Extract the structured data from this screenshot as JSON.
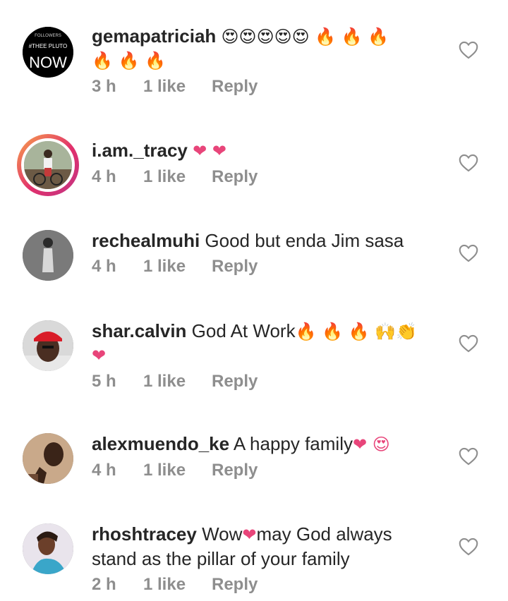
{
  "comments": [
    {
      "username": "gemapatriciah",
      "text": "",
      "emojis_line1": "😍😍😍😍😍 🔥 🔥 🔥",
      "emojis_line2": "🔥 🔥 🔥",
      "time": "3 h",
      "likes": "1 like",
      "reply": "Reply",
      "avatar_text_top": "FOLLOWERS",
      "avatar_text_mid": "#THEE PLUTO",
      "avatar_text_bottom": "NOW"
    },
    {
      "username": "i.am._tracy",
      "text": "",
      "emojis_line1": "❤ ❤",
      "time": "4 h",
      "likes": "1 like",
      "reply": "Reply"
    },
    {
      "username": "rechealmuhi",
      "text": "Good but enda Jim sasa",
      "time": "4 h",
      "likes": "1 like",
      "reply": "Reply"
    },
    {
      "username": "shar.calvin",
      "text": "God At Work",
      "emojis_line1": "🔥 🔥 🔥 🙌👏",
      "emojis_line2": "❤",
      "time": "5 h",
      "likes": "1 like",
      "reply": "Reply"
    },
    {
      "username": "alexmuendo_ke",
      "text": "A happy family",
      "emojis_line1": "❤ 😍",
      "time": "4 h",
      "likes": "1 like",
      "reply": "Reply"
    },
    {
      "username": "rhoshtracey",
      "text_part1": "Wow",
      "emoji_mid": "❤",
      "text_part2": "may God always",
      "text_line2": "stand as the pillar of your family",
      "time": "2 h",
      "likes": "1 like",
      "reply": "Reply"
    }
  ],
  "colors": {
    "text": "#262626",
    "meta": "#8e8e8e",
    "heart": "#e8457a",
    "fire": "#ff6a00",
    "story_ring_start": "#f7a34b",
    "story_ring_end": "#c13584"
  },
  "icons": {
    "like": "heart-outline-icon"
  }
}
